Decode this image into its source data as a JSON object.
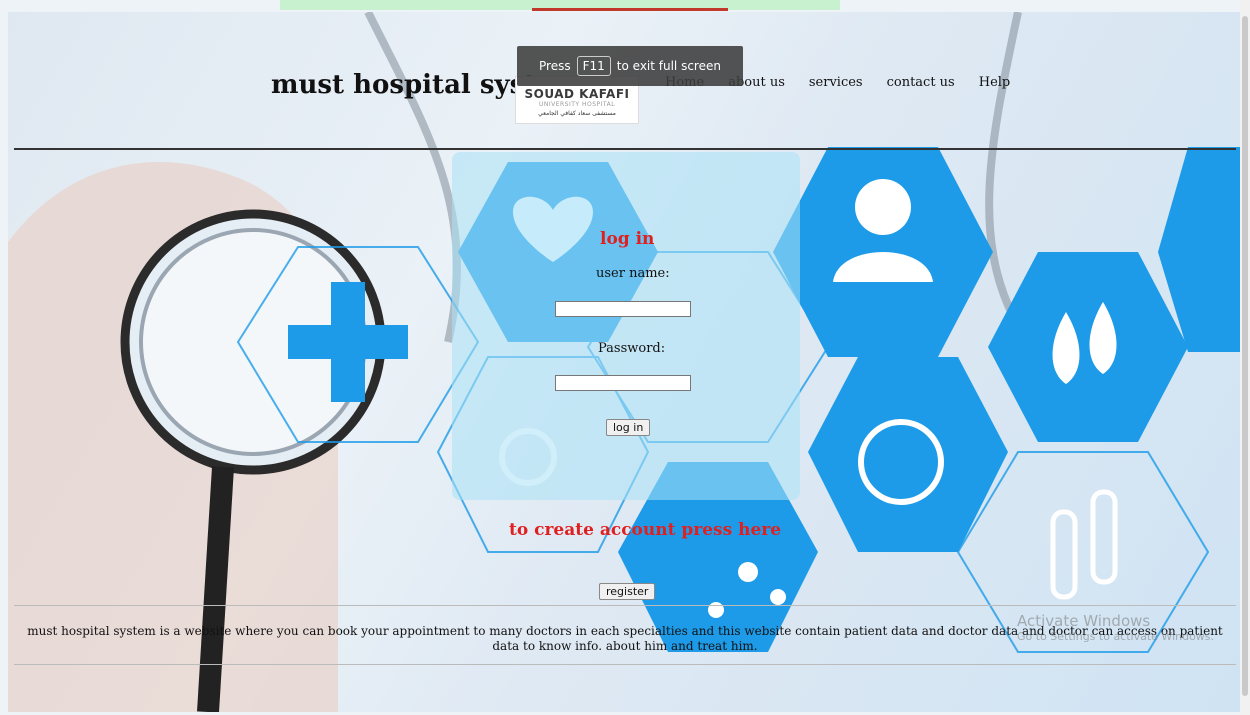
{
  "header": {
    "title": "must hospital system",
    "logo": {
      "main": "SOUAD KAFAFI",
      "sub": "UNIVERSITY HOSPITAL",
      "arabic": "مستشفى سعاد كفافي الجامعي"
    },
    "nav": [
      "Home",
      "about us",
      "services",
      "contact us",
      "Help"
    ]
  },
  "fullscreen_toast": {
    "before": "Press",
    "key": "F11",
    "after": "to exit full screen"
  },
  "login": {
    "title": "log in",
    "username_label": "user name:",
    "username_value": "",
    "password_label": "Password:",
    "password_value": "",
    "submit_label": "log in"
  },
  "register": {
    "prompt": "to create account press here",
    "button_label": "register"
  },
  "footer": {
    "description": "must hospital system is a website where you can book your appointment to many doctors in each specialties and this website contain patient data and doctor data and doctor can access on patient data to know info. about him and treat him."
  },
  "windows_watermark": {
    "title": "Activate Windows",
    "subtitle": "Go to Settings to activate Windows."
  },
  "colors": {
    "accent_red": "#e02020",
    "medical_blue": "#1d9be8",
    "panel": "#aae1f5"
  }
}
